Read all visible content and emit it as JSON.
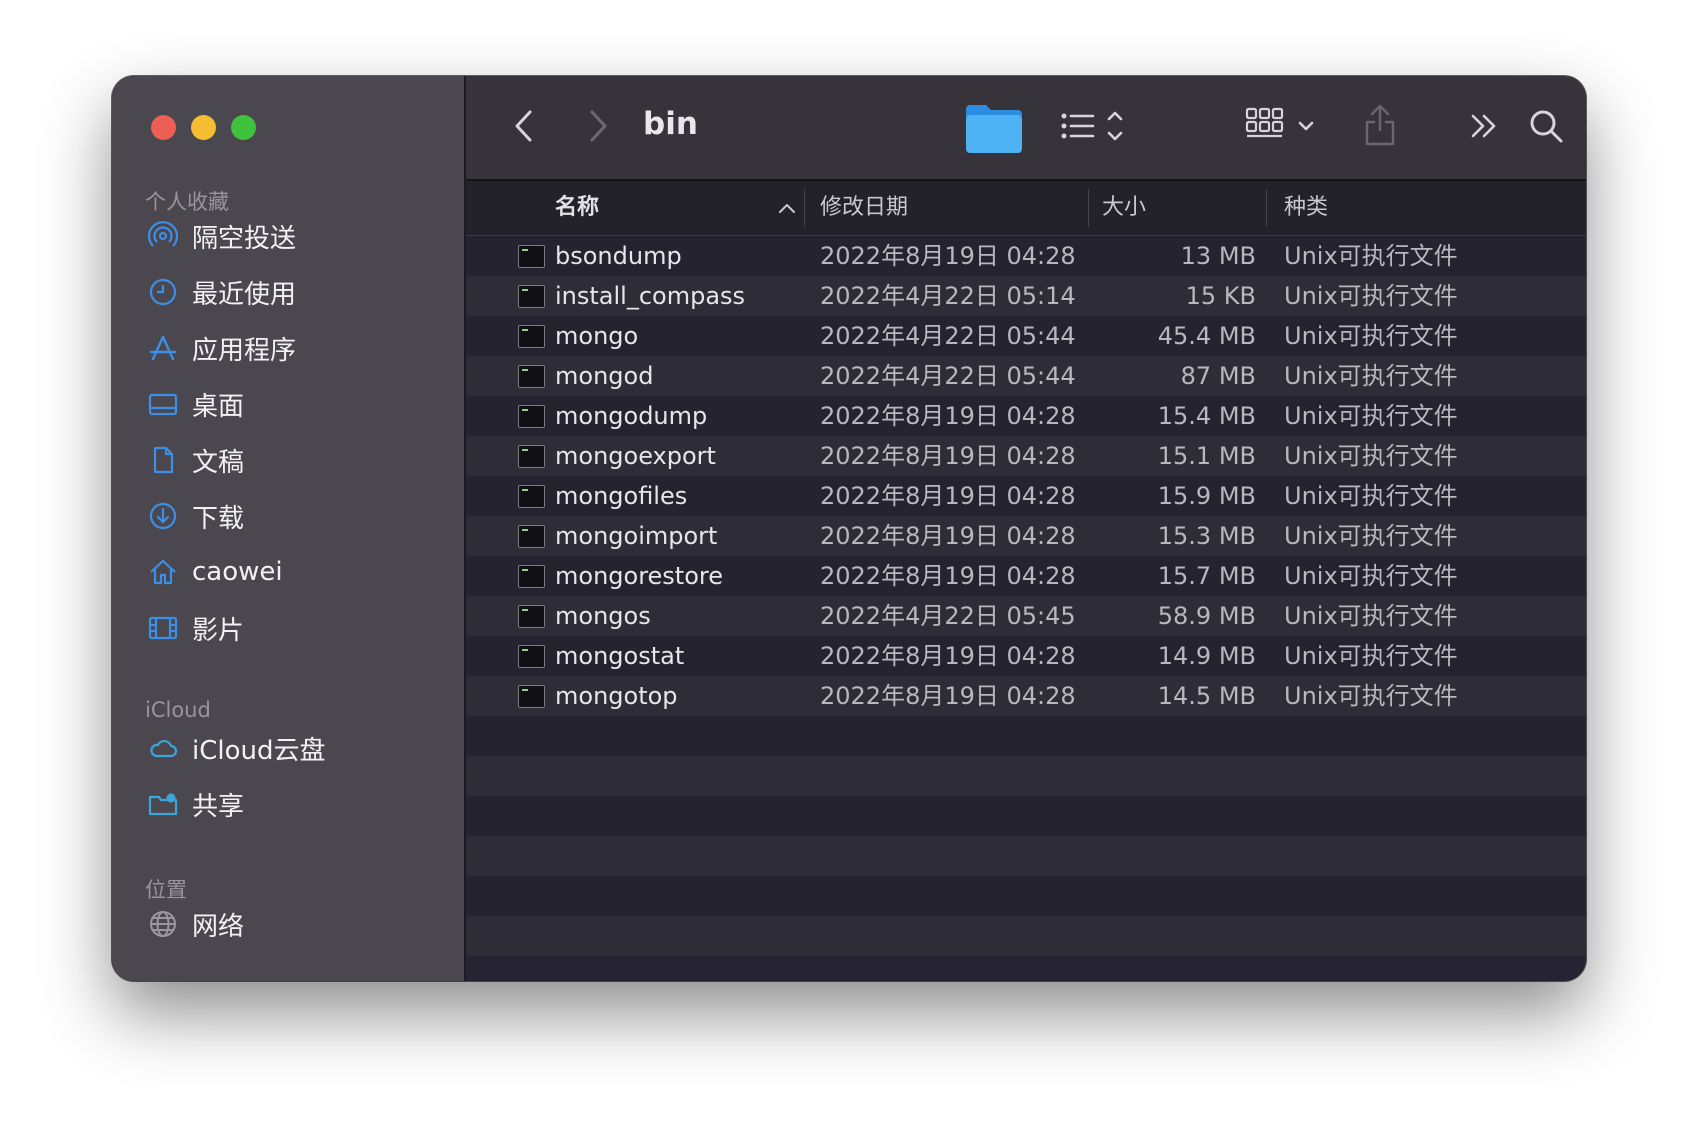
{
  "window": {
    "path_title": "bin"
  },
  "sidebar": {
    "sections": [
      {
        "title": "个人收藏",
        "items": [
          {
            "label": "隔空投送",
            "icon": "airdrop-icon"
          },
          {
            "label": "最近使用",
            "icon": "clock-icon"
          },
          {
            "label": "应用程序",
            "icon": "applications-icon"
          },
          {
            "label": "桌面",
            "icon": "desktop-icon"
          },
          {
            "label": "文稿",
            "icon": "document-icon"
          },
          {
            "label": "下载",
            "icon": "download-icon"
          },
          {
            "label": "caowei",
            "icon": "home-icon"
          },
          {
            "label": "影片",
            "icon": "film-icon"
          }
        ]
      },
      {
        "title": "iCloud",
        "items": [
          {
            "label": "iCloud云盘",
            "icon": "cloud-icon"
          },
          {
            "label": "共享",
            "icon": "shared-folder-icon"
          }
        ]
      },
      {
        "title": "位置",
        "items": [
          {
            "label": "网络",
            "icon": "globe-icon"
          }
        ]
      }
    ]
  },
  "toolbar": {
    "back_icon": "chevron-left-icon",
    "forward_icon": "chevron-right-icon",
    "folder_icon": "folder-icon",
    "view_icon": "list-view-icon",
    "group_icon": "group-grid-icon",
    "share_icon": "share-icon",
    "more_icon": "double-chevron-icon",
    "search_icon": "search-icon"
  },
  "columns": {
    "name": "名称",
    "date": "修改日期",
    "size": "大小",
    "kind": "种类"
  },
  "files": [
    {
      "name": "bsondump",
      "date": "2022年8月19日 04:28",
      "size": "13 MB",
      "kind": "Unix可执行文件"
    },
    {
      "name": "install_compass",
      "date": "2022年4月22日 05:14",
      "size": "15 KB",
      "kind": "Unix可执行文件"
    },
    {
      "name": "mongo",
      "date": "2022年4月22日 05:44",
      "size": "45.4 MB",
      "kind": "Unix可执行文件"
    },
    {
      "name": "mongod",
      "date": "2022年4月22日 05:44",
      "size": "87 MB",
      "kind": "Unix可执行文件"
    },
    {
      "name": "mongodump",
      "date": "2022年8月19日 04:28",
      "size": "15.4 MB",
      "kind": "Unix可执行文件"
    },
    {
      "name": "mongoexport",
      "date": "2022年8月19日 04:28",
      "size": "15.1 MB",
      "kind": "Unix可执行文件"
    },
    {
      "name": "mongofiles",
      "date": "2022年8月19日 04:28",
      "size": "15.9 MB",
      "kind": "Unix可执行文件"
    },
    {
      "name": "mongoimport",
      "date": "2022年8月19日 04:28",
      "size": "15.3 MB",
      "kind": "Unix可执行文件"
    },
    {
      "name": "mongorestore",
      "date": "2022年8月19日 04:28",
      "size": "15.7 MB",
      "kind": "Unix可执行文件"
    },
    {
      "name": "mongos",
      "date": "2022年4月22日 05:45",
      "size": "58.9 MB",
      "kind": "Unix可执行文件"
    },
    {
      "name": "mongostat",
      "date": "2022年8月19日 04:28",
      "size": "14.9 MB",
      "kind": "Unix可执行文件"
    },
    {
      "name": "mongotop",
      "date": "2022年8月19日 04:28",
      "size": "14.5 MB",
      "kind": "Unix可执行文件"
    }
  ]
}
